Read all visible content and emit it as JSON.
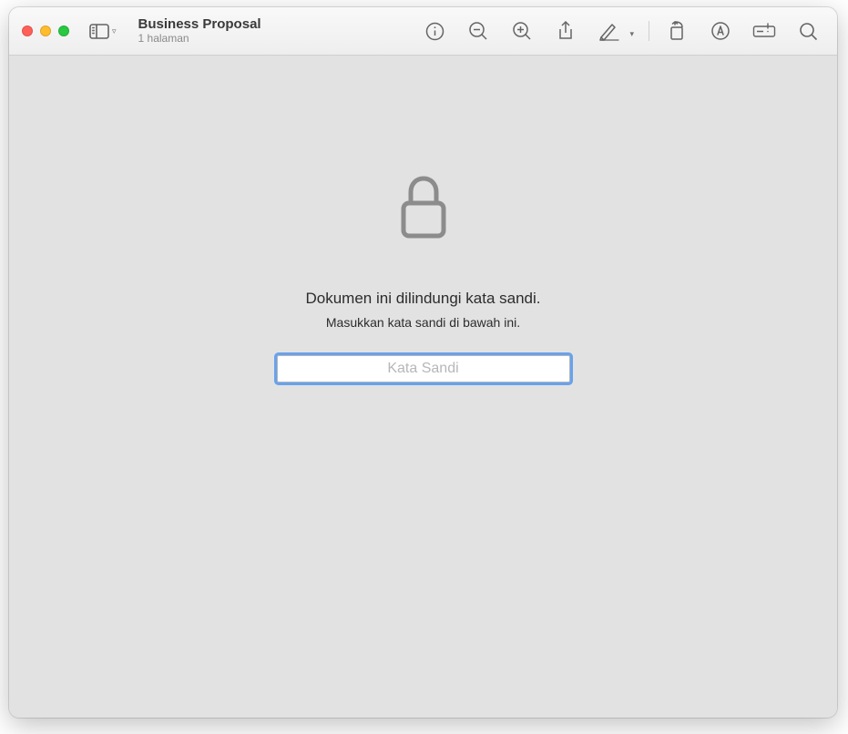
{
  "window": {
    "title": "Business Proposal",
    "subtitle": "1 halaman"
  },
  "prompt": {
    "heading": "Dokumen ini dilindungi kata sandi.",
    "subheading": "Masukkan kata sandi di bawah ini.",
    "placeholder": "Kata Sandi"
  },
  "toolbar": {
    "icons": {
      "sidebar": "sidebar-icon",
      "info": "info-icon",
      "zoom_out": "zoom-out-icon",
      "zoom_in": "zoom-in-icon",
      "share": "share-icon",
      "markup": "markup-icon",
      "rotate": "rotate-icon",
      "highlight": "highlight-icon",
      "form_fill": "form-fill-icon",
      "search": "search-icon"
    }
  }
}
